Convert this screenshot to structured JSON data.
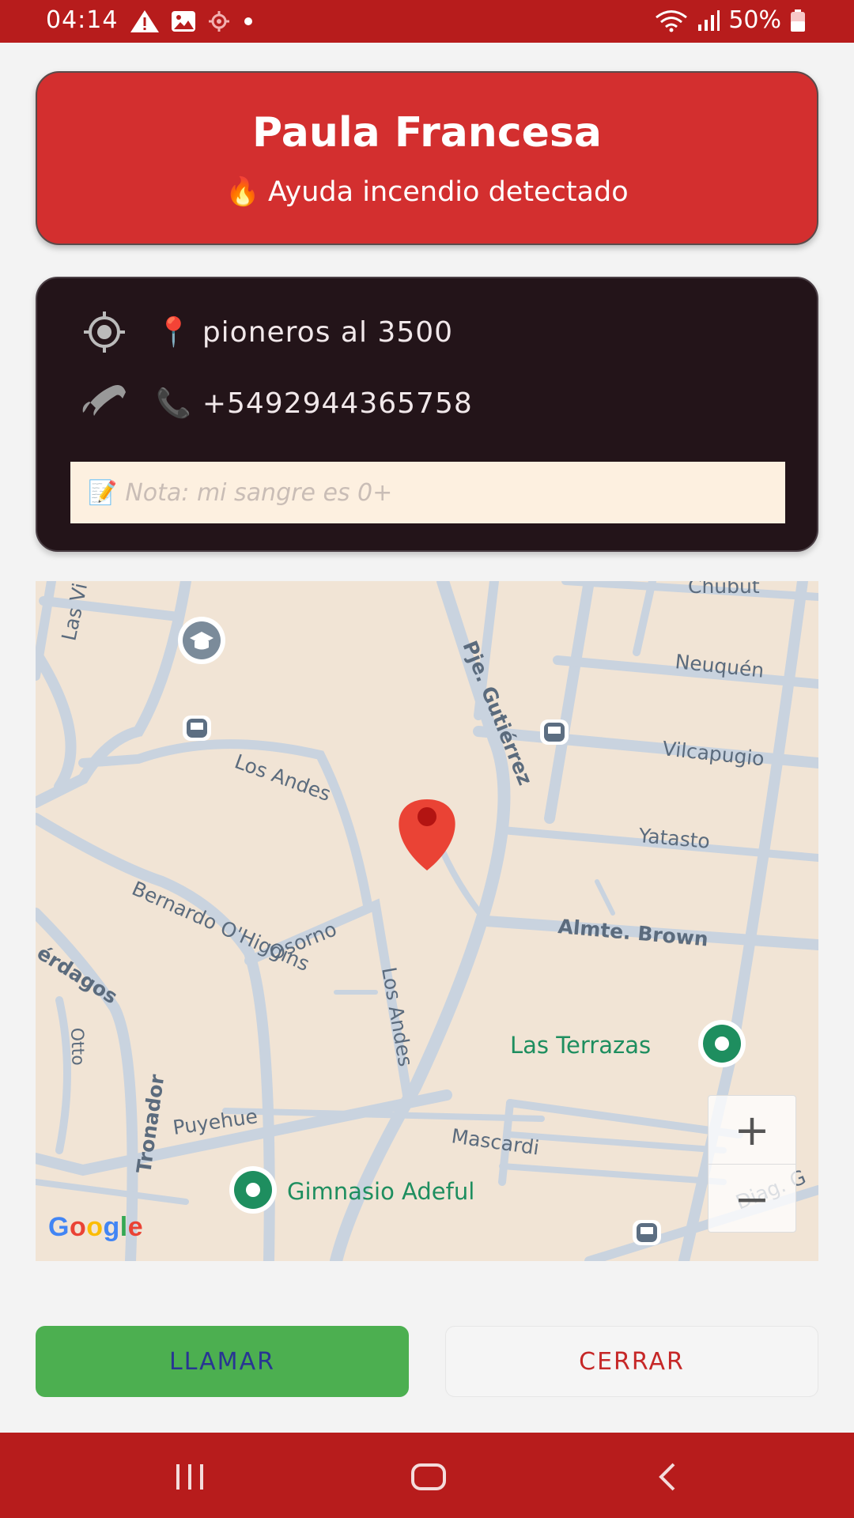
{
  "status_bar": {
    "time": "04:14",
    "battery": "50%",
    "icons": [
      "warning-icon",
      "image-icon",
      "location-icon",
      "dot-icon",
      "wifi-icon",
      "signal-icon",
      "battery-icon"
    ]
  },
  "header": {
    "name": "Paula Francesa",
    "alert_emoji": "🔥",
    "alert": "Ayuda incendio detectado"
  },
  "info": {
    "location_emoji": "📍",
    "address": "pioneros al 3500",
    "phone_emoji": "📞",
    "phone": "+5492944365758",
    "note_emoji": "📝",
    "note_placeholder": "Nota: mi sangre es 0+"
  },
  "map": {
    "streets": [
      "Las Vi",
      "Chubut",
      "Neuquén",
      "Pje. Gutiérrez",
      "Vilcapugio",
      "Los Andes",
      "Yatasto",
      "Bernardo O'Higgins",
      "Osorno",
      "Almte. Brown",
      "érdagos",
      "Los Andes",
      "Otto",
      "Tronador",
      "Puyehue",
      "Mascardi",
      "Diag. G"
    ],
    "places": [
      "Las Terrazas",
      "Gimnasio Adeful"
    ],
    "zoom_in": "+",
    "zoom_out": "−",
    "attribution": [
      "G",
      "o",
      "o",
      "g",
      "l",
      "e"
    ]
  },
  "buttons": {
    "call": "LLAMAR",
    "close": "CERRAR"
  },
  "colors": {
    "primary": "#b71c1c",
    "header_card": "#d32f2f",
    "info_card": "#231419",
    "call_button": "#4caf50",
    "place_green": "#1e8e5f",
    "map_bg": "#f1e4d5"
  }
}
